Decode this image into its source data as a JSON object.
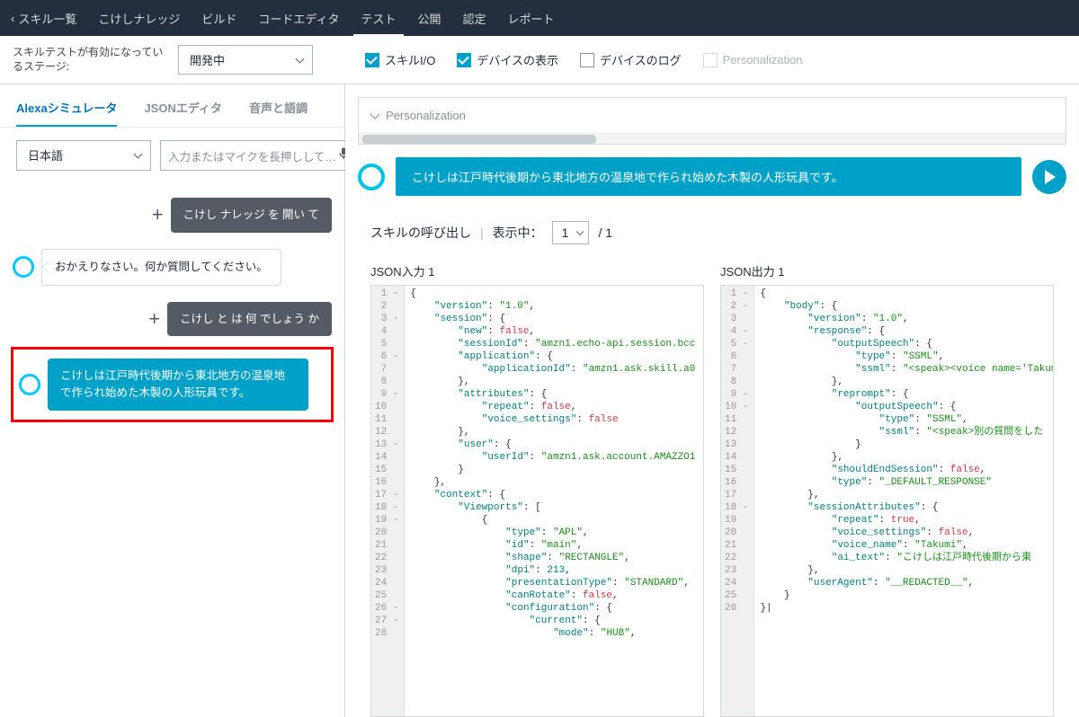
{
  "topnav": {
    "back": "スキル一覧",
    "items": [
      "こけしナレッジ",
      "ビルド",
      "コードエディタ",
      "テスト",
      "公開",
      "認定",
      "レポート"
    ],
    "active_index": 3
  },
  "toolbar": {
    "stage_label": "スキルテストが有効になっているステージ:",
    "stage_value": "開発中",
    "checks": [
      {
        "label": "スキルI/O",
        "checked": true
      },
      {
        "label": "デバイスの表示",
        "checked": true
      },
      {
        "label": "デバイスのログ",
        "checked": false
      },
      {
        "label": "Personalization",
        "checked": false,
        "disabled": true
      }
    ]
  },
  "simtabs": {
    "items": [
      "Alexaシミュレータ",
      "JSONエディタ",
      "音声と語調"
    ],
    "active_index": 0
  },
  "input": {
    "lang": "日本語",
    "placeholder": "入力またはマイクを長押しして…"
  },
  "conversation": [
    {
      "role": "user",
      "text": "こけし ナレッジ を 開い て",
      "plus": true
    },
    {
      "role": "assistant",
      "text": "おかえりなさい。何か質問してください。"
    },
    {
      "role": "user",
      "text": "こけし と は 何 でしょう か",
      "plus": true
    },
    {
      "role": "assistant",
      "text": "こけしは江戸時代後期から東北地方の温泉地で作られ始めた木製の人形玩具です。",
      "highlight": true
    }
  ],
  "main": {
    "personalization": "Personalization",
    "response": "こけしは江戸時代後期から東北地方の温泉地で作られ始めた木製の人形玩具です。",
    "invoke_label": "スキルの呼び出し",
    "display_label": "表示中：",
    "page": "1",
    "total": "/ 1",
    "input_title": "JSON入力 1",
    "output_title": "JSON出力 1"
  },
  "json_input": [
    "{",
    "    \"version\": \"1.0\",",
    "    \"session\": {",
    "        \"new\": false,",
    "        \"sessionId\": \"amzn1.echo-api.session.bcc",
    "        \"application\": {",
    "            \"applicationId\": \"amzn1.ask.skill.a0",
    "        },",
    "        \"attributes\": {",
    "            \"repeat\": false,",
    "            \"voice_settings\": false",
    "        },",
    "        \"user\": {",
    "            \"userId\": \"amzn1.ask.account.AMAZZO1",
    "        }",
    "    },",
    "    \"context\": {",
    "        \"Viewports\": [",
    "            {",
    "                \"type\": \"APL\",",
    "                \"id\": \"main\",",
    "                \"shape\": \"RECTANGLE\",",
    "                \"dpi\": 213,",
    "                \"presentationType\": \"STANDARD\",",
    "                \"canRotate\": false,",
    "                \"configuration\": {",
    "                    \"current\": {",
    "                        \"mode\": \"HUB\","
  ],
  "json_output": [
    "{",
    "    \"body\": {",
    "        \"version\": \"1.0\",",
    "        \"response\": {",
    "            \"outputSpeech\": {",
    "                \"type\": \"SSML\",",
    "                \"ssml\": \"<speak><voice name='Takum",
    "            },",
    "            \"reprompt\": {",
    "                \"outputSpeech\": {",
    "                    \"type\": \"SSML\",",
    "                    \"ssml\": \"<speak>別の質問をした",
    "                }",
    "            },",
    "            \"shouldEndSession\": false,",
    "            \"type\": \"_DEFAULT_RESPONSE\"",
    "        },",
    "        \"sessionAttributes\": {",
    "            \"repeat\": true,",
    "            \"voice_settings\": false,",
    "            \"voice_name\": \"Takumi\",",
    "            \"ai_text\": \"こけしは江戸時代後期から東",
    "        },",
    "        \"userAgent\": \"__REDACTED__\",",
    "    }",
    "}|"
  ],
  "input_fold": {
    "1": "-",
    "2": "",
    "3": "-",
    "4": "",
    "5": "",
    "6": "-",
    "7": "",
    "8": "",
    "9": "-",
    "10": "",
    "11": "",
    "12": "",
    "13": "-",
    "14": "",
    "15": "",
    "16": "",
    "17": "-",
    "18": "-",
    "19": "-",
    "20": "",
    "21": "",
    "22": "",
    "23": "",
    "24": "",
    "25": "",
    "26": "-",
    "27": "-",
    "28": ""
  },
  "output_fold": {
    "1": "-",
    "2": "-",
    "3": "",
    "4": "-",
    "5": "-",
    "6": "",
    "7": "",
    "8": "",
    "9": "-",
    "10": "-",
    "11": "",
    "12": "",
    "13": "",
    "14": "",
    "15": "",
    "16": "",
    "17": "",
    "18": "-",
    "19": "",
    "20": "",
    "21": "",
    "22": "",
    "23": "",
    "24": "",
    "25": "",
    "26": ""
  }
}
